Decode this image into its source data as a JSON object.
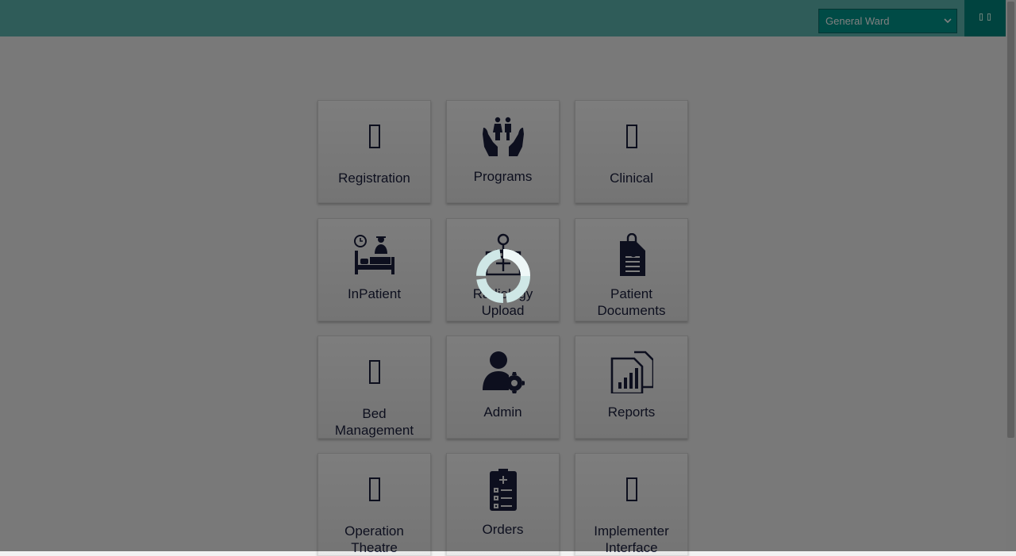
{
  "header": {
    "location_select": {
      "value": "General Ward"
    },
    "user_menu": {
      "icons": [
        "user-icon",
        "caret-icon"
      ]
    }
  },
  "tiles": [
    {
      "label": "Registration",
      "icon": "registration-icon"
    },
    {
      "label": "Programs",
      "icon": "family-care-icon"
    },
    {
      "label": "Clinical",
      "icon": "clinical-icon"
    },
    {
      "label": "InPatient",
      "icon": "inpatient-bed-icon"
    },
    {
      "label": "Radiology Upload",
      "icon": "radiology-xray-icon"
    },
    {
      "label": "Patient Documents",
      "icon": "documents-clip-icon"
    },
    {
      "label": "Bed Management",
      "icon": "bed-management-icon"
    },
    {
      "label": "Admin",
      "icon": "admin-user-gear-icon"
    },
    {
      "label": "Reports",
      "icon": "reports-chart-icon"
    },
    {
      "label": "Operation Theatre",
      "icon": "operation-theatre-icon"
    },
    {
      "label": "Orders",
      "icon": "orders-clipboard-icon"
    },
    {
      "label": "Implementer Interface",
      "icon": "implementer-interface-icon"
    }
  ],
  "colors": {
    "header": "#5fb8b3",
    "select_bg": "#00978d",
    "icon": "#1a1f3d"
  },
  "loading_spinner": "loading-spinner-icon"
}
